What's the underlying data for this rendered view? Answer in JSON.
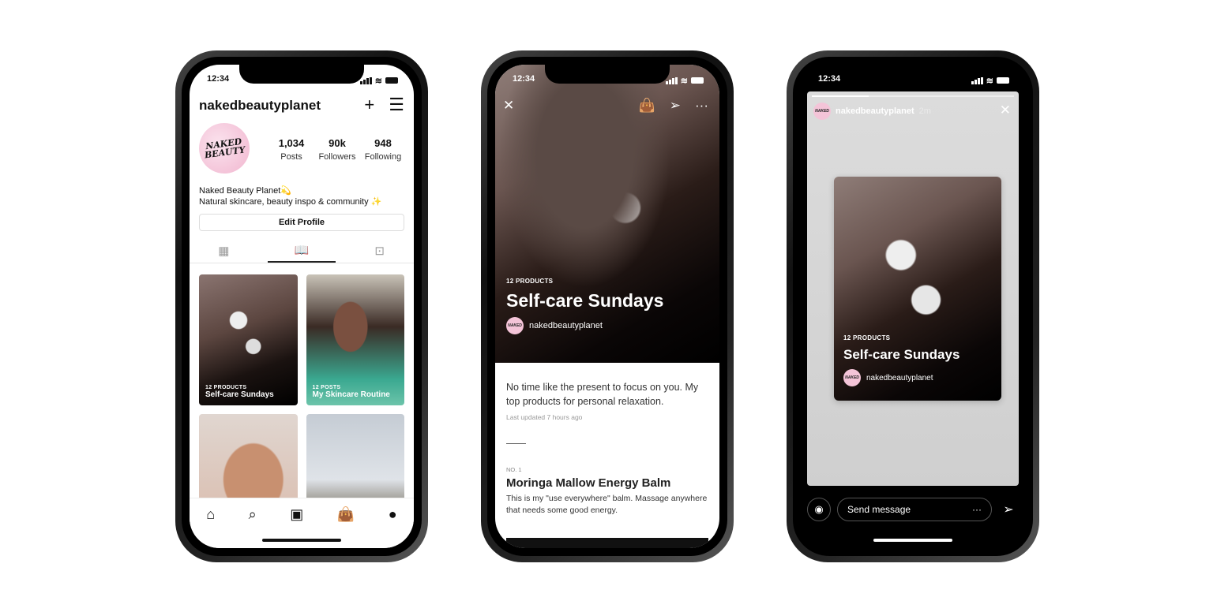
{
  "status_time": "12:34",
  "profile": {
    "username": "nakedbeautyplanet",
    "avatar_text": "NAKED BEAUTY",
    "stats": [
      {
        "value": "1,034",
        "label": "Posts"
      },
      {
        "value": "90k",
        "label": "Followers"
      },
      {
        "value": "948",
        "label": "Following"
      }
    ],
    "bio_name": "Naked Beauty Planet💫",
    "bio_text": "Natural skincare, beauty inspo & community ✨",
    "edit_label": "Edit Profile",
    "tabs": [
      {
        "icon": "grid-icon",
        "active": false
      },
      {
        "icon": "guide-icon",
        "active": true
      },
      {
        "icon": "tagged-icon",
        "active": false
      }
    ],
    "guides": [
      {
        "meta": "12 PRODUCTS",
        "title": "Self-care Sundays"
      },
      {
        "meta": "12 POSTS",
        "title": "My Skincare Routine"
      },
      {
        "meta": "",
        "title": ""
      },
      {
        "meta": "",
        "title": ""
      }
    ],
    "nav": [
      "home-icon",
      "search-icon",
      "reels-icon",
      "shop-icon",
      "profile-icon"
    ]
  },
  "guide": {
    "meta": "12 PRODUCTS",
    "title": "Self-care Sundays",
    "author": "nakedbeautyplanet",
    "description": "No time like the present to focus on you. My top products for personal relaxation.",
    "updated": "Last updated 7 hours ago",
    "item_no": "NO. 1",
    "item_title": "Moringa Mallow Energy Balm",
    "item_desc": "This is my \"use everywhere\" balm. Massage anywhere that needs some good energy."
  },
  "story": {
    "username": "nakedbeautyplanet",
    "time": "2m",
    "progress": 0.28,
    "card_meta": "12 PRODUCTS",
    "card_title": "Self-care Sundays",
    "card_author": "nakedbeautyplanet",
    "message_placeholder": "Send message"
  }
}
